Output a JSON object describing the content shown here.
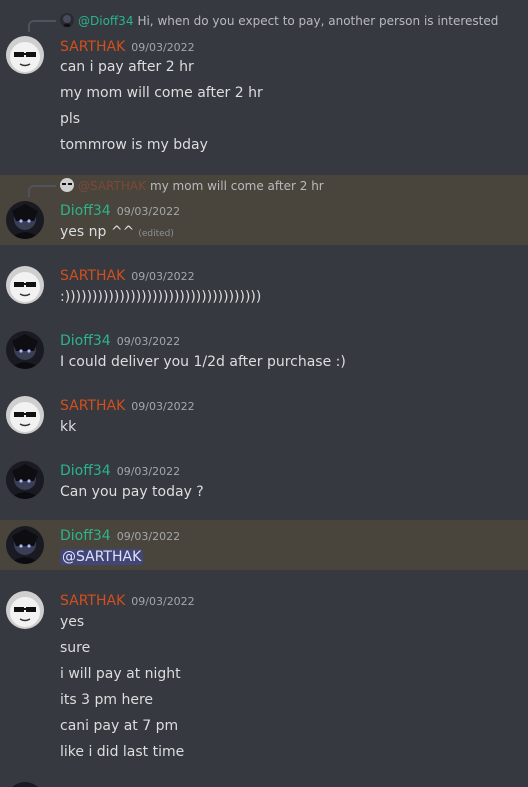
{
  "users": {
    "sarthak": {
      "name": "SARTHAK",
      "color": "#d34f1d"
    },
    "dioff": {
      "name": "Dioff34",
      "color": "#2bb58b"
    }
  },
  "messages": [
    {
      "author": "SARTHAK",
      "timestamp": "09/03/2022",
      "reply": {
        "user": "@Dioff34",
        "text": "Hi, when do you expect to pay, another person is interested"
      },
      "lines": [
        "can i pay after 2 hr",
        "my mom will come after 2 hr",
        "pls",
        "tommrow is my bday"
      ]
    },
    {
      "author": "Dioff34",
      "timestamp": "09/03/2022",
      "reply": {
        "user": "@SARTHAK",
        "text": "my mom will come after 2 hr"
      },
      "lines": [
        "yes np ^^"
      ],
      "edited": "(edited)"
    },
    {
      "author": "SARTHAK",
      "timestamp": "09/03/2022",
      "lines": [
        ":))))))))))))))))))))))))))))))))))))"
      ]
    },
    {
      "author": "Dioff34",
      "timestamp": "09/03/2022",
      "lines": [
        "I could deliver you 1/2d after purchase :)"
      ]
    },
    {
      "author": "SARTHAK",
      "timestamp": "09/03/2022",
      "lines": [
        "kk"
      ]
    },
    {
      "author": "Dioff34",
      "timestamp": "09/03/2022",
      "lines": [
        "Can you pay today ?"
      ]
    },
    {
      "author": "Dioff34",
      "timestamp": "09/03/2022",
      "lines": [
        "@SARTHAK"
      ]
    },
    {
      "author": "SARTHAK",
      "timestamp": "09/03/2022",
      "lines": [
        "yes",
        "sure",
        "i will pay at night",
        "its 3 pm here",
        "cani pay at 7 pm",
        "like i did last time"
      ]
    }
  ]
}
